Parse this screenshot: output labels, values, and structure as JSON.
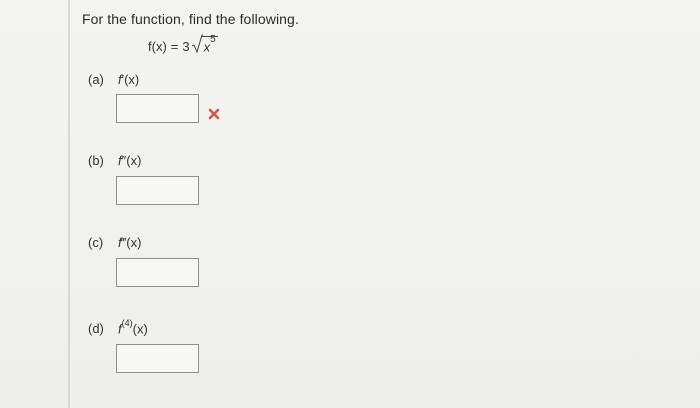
{
  "question": {
    "prompt": "For the function, find the following.",
    "formula": {
      "lhs": "f(x)",
      "equals": "=",
      "coefficient": "3",
      "radicand_base": "x",
      "radicand_exponent": "5"
    }
  },
  "parts": [
    {
      "letter": "(a)",
      "func": "f",
      "primes": "′",
      "arg": "(x)",
      "answer_value": "",
      "status": "incorrect",
      "status_icon": "red-x-icon",
      "status_color": "#d9534f"
    },
    {
      "letter": "(b)",
      "func": "f",
      "primes": "″",
      "arg": "(x)",
      "answer_value": ""
    },
    {
      "letter": "(c)",
      "func": "f",
      "primes": "‴",
      "arg": "(x)",
      "answer_value": ""
    },
    {
      "letter": "(d)",
      "func": "f",
      "sup": "(4)",
      "arg": "(x)",
      "answer_value": ""
    }
  ]
}
